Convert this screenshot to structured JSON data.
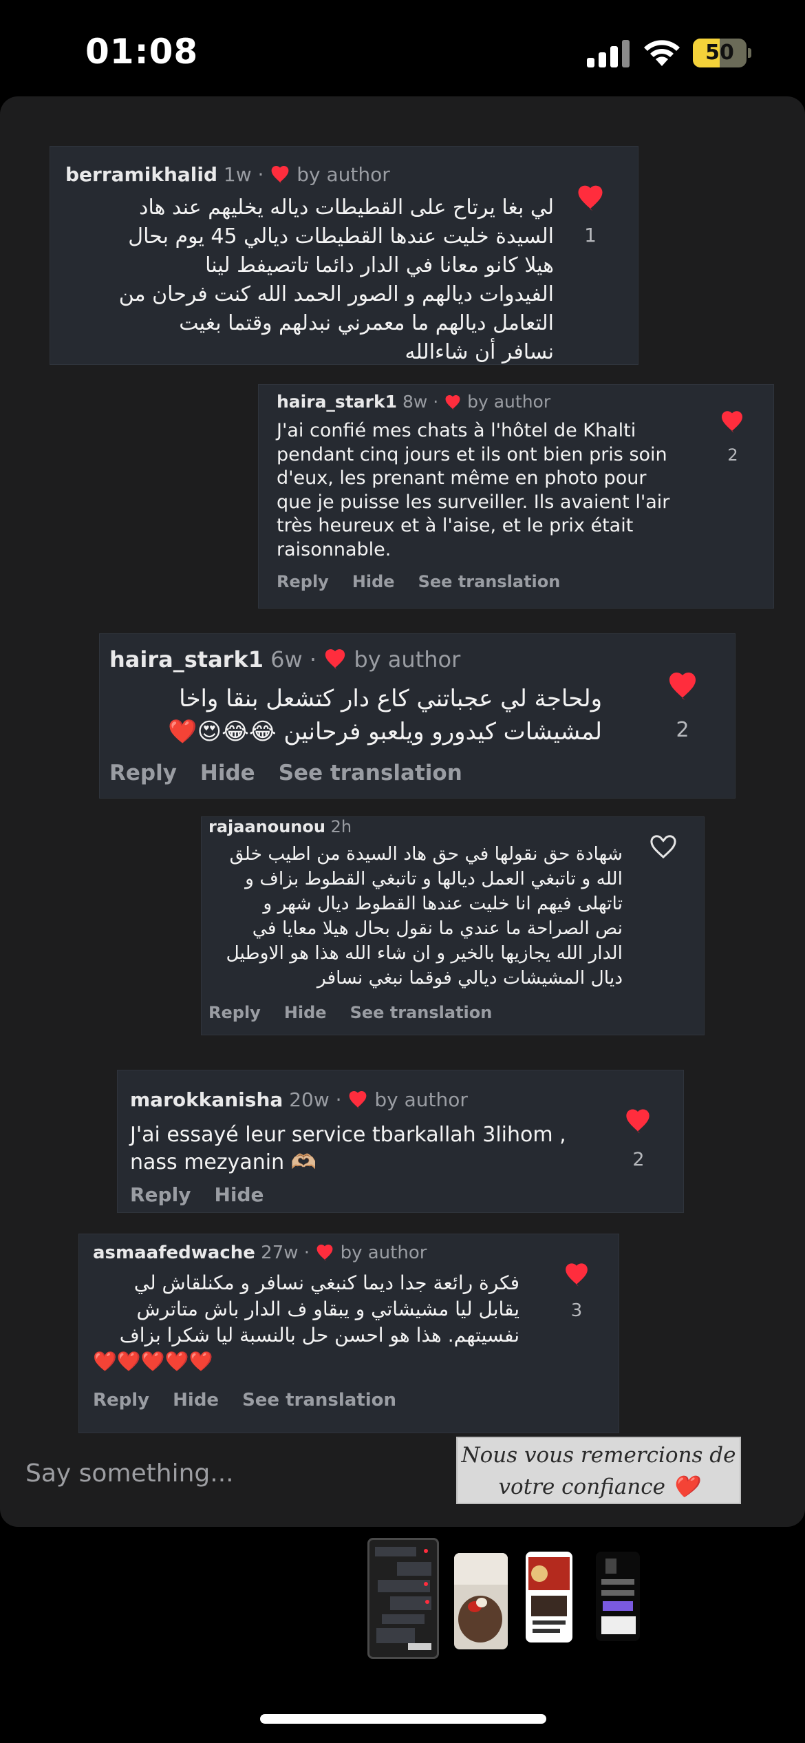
{
  "status": {
    "time": "01:08",
    "battery": "50",
    "battery_level": 0.5
  },
  "comments": [
    {
      "username": "berramikhalid",
      "time": "1w",
      "by_author": "by author",
      "text_lines": [
        "لي بغا يرتاح على القطيطات دياله يخليهم عند هاد",
        "السيدة خليت عندها القطيطات ديالي 45 يوم بحال",
        "هيلا كانو  معانا في الدار دائما  تاتصيفط لينا",
        "الفيدوات ديالهم و الصور الحمد الله كنت فرحان من",
        "التعامل ديالهم  ما معمرني نبدلهم وقتما بغيت",
        "نسافر أن شاءالله"
      ],
      "like_count": "1",
      "liked": true
    },
    {
      "username": "haira_stark1",
      "time": "8w",
      "by_author": "by author",
      "text_lines": [
        "J'ai confié mes chats à l'hôtel de Khalti",
        "pendant cinq jours et ils ont bien pris soin",
        "d'eux, les prenant même en photo pour",
        "que je puisse les surveiller. Ils avaient l'air",
        "très heureux et à l'aise, et le prix était",
        "raisonnable."
      ],
      "actions": {
        "reply": "Reply",
        "hide": "Hide",
        "translate": "See translation"
      },
      "like_count": "2",
      "liked": true
    },
    {
      "username": "haira_stark1",
      "time": "6w",
      "by_author": "by author",
      "text_lines": [
        "ولحاجة لي عجباتني كاع دار كتشعل بنقا واخا",
        "لمشيشات كيدورو ويلعبو فرحانين 😂😂😍❤️"
      ],
      "actions": {
        "reply": "Reply",
        "hide": "Hide",
        "translate": "See translation"
      },
      "like_count": "2",
      "liked": true
    },
    {
      "username": "rajaanounou",
      "time": "2h",
      "text_lines": [
        "شهادة حق نقولها في حق هاد السيدة من اطيب خلق",
        "الله و تاتبغي العمل ديالها و تاتبغي القطوط بزاف و",
        "تاتهلى فيهم انا خليت عندها القطوط ديال شهر و",
        "نص الصراحة ما عندي ما نقول بحال هيلا معايا في",
        "الدار الله يجازيها بالخير و ان شاء الله هذا هو الاوطيل",
        "ديال المشيشات ديالي فوقما نبغي نسافر"
      ],
      "actions": {
        "reply": "Reply",
        "hide": "Hide",
        "translate": "See translation"
      },
      "liked": false
    },
    {
      "username": "marokkanisha",
      "time": "20w",
      "by_author": "by author",
      "text_lines": [
        "J'ai essayé leur service tbarkallah 3lihom ,",
        "nass mezyanin 🫶🏼"
      ],
      "actions": {
        "reply": "Reply",
        "hide": "Hide"
      },
      "like_count": "2",
      "liked": true
    },
    {
      "username": "asmaafedwache",
      "time": "27w",
      "by_author": "by author",
      "text_lines": [
        "فكرة رائعة جدا ديما كنبغي نسافر و مكنلقاش لي",
        "يقابل ليا مشيشاتي و يبقاو ف الدار باش متاترش",
        "نفسيتهم. هذا هو احسن حل بالنسبة ليا شكرا بزاف",
        "❤️❤️❤️❤️❤️"
      ],
      "actions": {
        "reply": "Reply",
        "hide": "Hide",
        "translate": "See translation"
      },
      "like_count": "3",
      "liked": true
    }
  ],
  "composer": {
    "placeholder": "Say something..."
  },
  "sticker": {
    "line1": "Nous vous remercions de",
    "line2": "votre confiance ❤️"
  },
  "colors": {
    "heart": "#ff2d3d",
    "card": "#262a31",
    "panel": "#1d1d1e"
  }
}
